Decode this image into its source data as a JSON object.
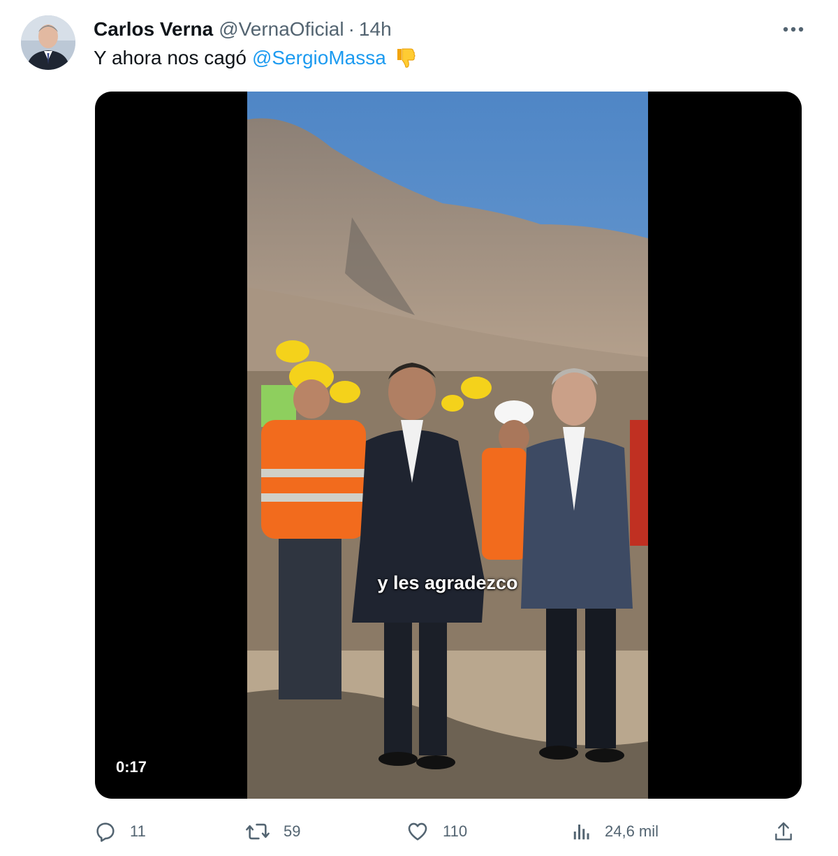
{
  "tweet": {
    "author": {
      "display_name": "Carlos Verna",
      "handle": "@VernaOficial",
      "separator": "·",
      "time": "14h"
    },
    "text": "Y ahora nos cagó",
    "mention": "@SergioMassa",
    "emoji_icon": "thumbs-down-icon",
    "video": {
      "caption": "y les agradezco",
      "duration": "0:17"
    },
    "metrics": {
      "replies": "11",
      "retweets": "59",
      "likes": "110",
      "views": "24,6 mil"
    }
  },
  "colors": {
    "accent": "#1d9bf0",
    "secondary_text": "#536471",
    "primary_text": "#0f1419"
  }
}
